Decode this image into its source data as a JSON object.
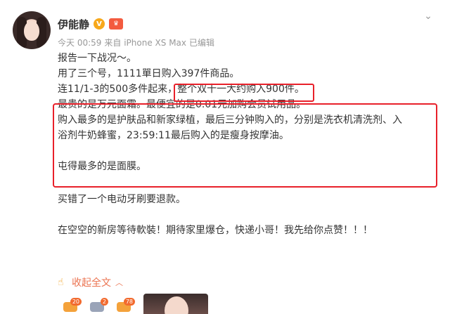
{
  "user": {
    "name": "伊能静",
    "verified_badge": "V",
    "crown_badge": "♛",
    "avatar_icon": "avatar"
  },
  "meta": {
    "time": "今天 00:59",
    "source": "来自 iPhone XS Max",
    "edited": "已编辑"
  },
  "post": {
    "l1": "报告一下战况～。",
    "l2": "用了三个号，1111單日购入397件商品。",
    "l3a": "连11/1-3的500多件起来，",
    "l3b": "整个双十一大约购入900件。",
    "l4": "最贵的是万元面霜。最便宜的是0.01元加购会员试用品。",
    "l5": "购入最多的是护肤品和新家绿植，最后三分钟购入的，分别是洗衣机清洗剂、入",
    "l6": "浴剂牛奶蜂蜜，23:59:11最后购入的是瘦身按摩油。",
    "l7": "屯得最多的是面膜。",
    "l8": "买错了一个电动牙刷要退款。",
    "l9": "在空空的新房等待軟裝！期待家里爆仓，快递小哥！我先给你点赞！！！"
  },
  "actions": {
    "collapse_label": "收起全文",
    "chevron": "︿"
  },
  "reactions": [
    {
      "count": "20"
    },
    {
      "count": "2"
    },
    {
      "count": "78"
    }
  ],
  "colors": {
    "highlight_border": "#e8202a",
    "link_orange": "#eb7350"
  }
}
